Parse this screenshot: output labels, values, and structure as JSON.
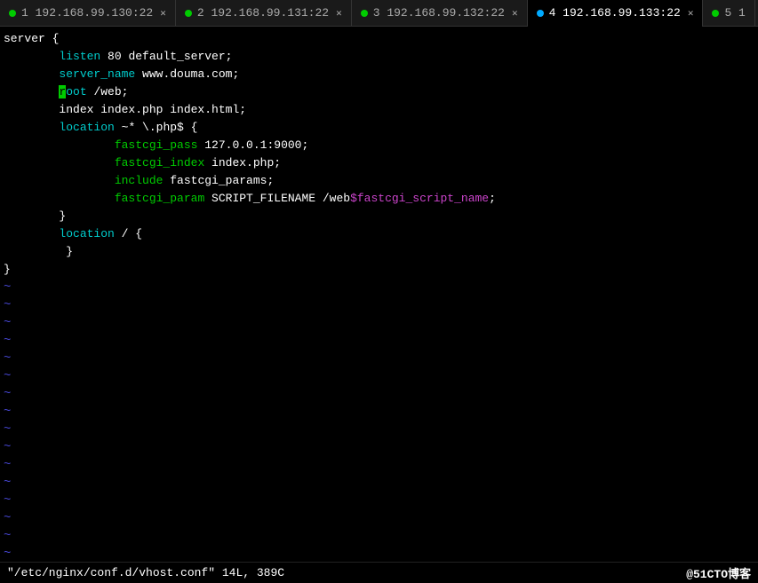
{
  "tabs": [
    {
      "id": "tab1",
      "label": "1 192.168.99.130:22",
      "dot_color": "#00cc00",
      "active": false,
      "closable": true
    },
    {
      "id": "tab2",
      "label": "2 192.168.99.131:22",
      "dot_color": "#00cc00",
      "active": false,
      "closable": true
    },
    {
      "id": "tab3",
      "label": "3 192.168.99.132:22",
      "dot_color": "#00cc00",
      "active": false,
      "closable": true
    },
    {
      "id": "tab4",
      "label": "4 192.168.99.133:22",
      "dot_color": "#00aaff",
      "active": true,
      "closable": true
    },
    {
      "id": "tab5",
      "label": "5 1",
      "dot_color": "#00cc00",
      "active": false,
      "closable": false
    }
  ],
  "status": {
    "file_info": "\"/etc/nginx/conf.d/vhost.conf\" 14L, 389C",
    "watermark": "@51CTO博客"
  },
  "editor": {
    "lines": [
      {
        "num": "",
        "tilde": false,
        "blank": false,
        "content_html": "server {"
      },
      {
        "num": "",
        "tilde": false,
        "blank": false,
        "content_html": "        <span class='kw-cyan'>listen</span> 80 default_server;"
      },
      {
        "num": "",
        "tilde": false,
        "blank": false,
        "content_html": "        <span class='kw-cyan'>server_name</span> www.douma.com;"
      },
      {
        "num": "",
        "tilde": false,
        "blank": false,
        "content_html": "        <span class='kw-highlight'>r</span><span class='kw-cyan'>oot</span> /web;"
      },
      {
        "num": "",
        "tilde": false,
        "blank": false,
        "content_html": "        index index.php index.html;"
      },
      {
        "num": "",
        "tilde": false,
        "blank": false,
        "content_html": "        <span class='kw-cyan'>location</span> ~* \\.php$ {"
      },
      {
        "num": "",
        "tilde": false,
        "blank": false,
        "content_html": "                <span class='kw-green'>fastcgi_pass</span> 127.0.0.1:9000;"
      },
      {
        "num": "",
        "tilde": false,
        "blank": false,
        "content_html": "                <span class='kw-green'>fastcgi_index</span> index.php;"
      },
      {
        "num": "",
        "tilde": false,
        "blank": false,
        "content_html": "                <span class='kw-green'>include</span> fastcgi_params;"
      },
      {
        "num": "",
        "tilde": false,
        "blank": false,
        "content_html": "                <span class='kw-green'>fastcgi_param</span> SCRIPT_FILENAME /web<span class='variable-highlight'>$fastcgi_script_name</span>;"
      },
      {
        "num": "",
        "tilde": false,
        "blank": false,
        "content_html": "        }"
      },
      {
        "num": "",
        "tilde": false,
        "blank": false,
        "content_html": "        <span class='kw-cyan'>location</span> / {"
      },
      {
        "num": "",
        "tilde": false,
        "blank": false,
        "content_html": "         }"
      },
      {
        "num": "",
        "tilde": false,
        "blank": false,
        "content_html": "}"
      }
    ]
  }
}
